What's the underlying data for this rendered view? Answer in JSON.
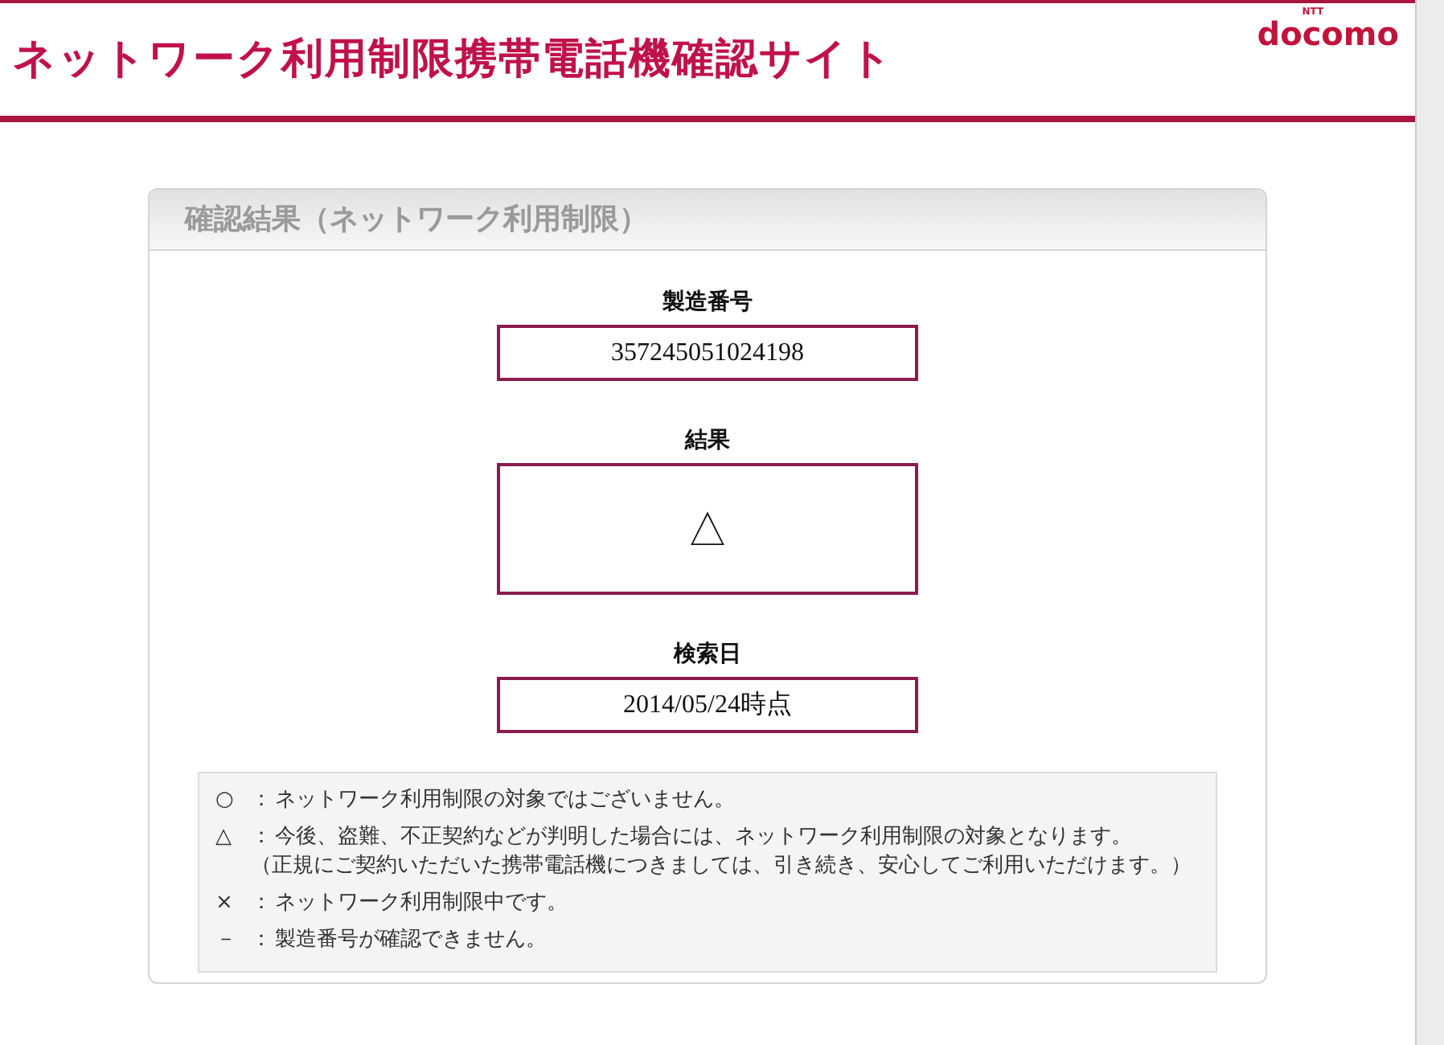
{
  "header": {
    "title": "ネットワーク利用制限携帯電話機確認サイト",
    "logo": {
      "caption": "NTT",
      "text": "docomo"
    }
  },
  "result_panel": {
    "title": "確認結果（ネットワーク利用制限）",
    "fields": [
      {
        "label": "製造番号",
        "value": "357245051024198",
        "kind": "text"
      },
      {
        "label": "結果",
        "value": "△",
        "kind": "symbol"
      },
      {
        "label": "検索日",
        "value": "2014/05/24時点",
        "kind": "text"
      }
    ]
  },
  "legend": [
    {
      "symbol": "○",
      "separator": "：",
      "text": "ネットワーク利用制限の対象ではございません。"
    },
    {
      "symbol": "△",
      "separator": "：",
      "text": "今後、盗難、不正契約などが判明した場合には、ネットワーク利用制限の対象となります。",
      "note": "（正規にご契約いただいた携帯電話機につきましては、引き続き、安心してご利用いただけます。）"
    },
    {
      "symbol": "×",
      "separator": "：",
      "text": "ネットワーク利用制限中です。"
    },
    {
      "symbol": "－",
      "separator": "：",
      "text": "製造番号が確認できません。"
    }
  ]
}
